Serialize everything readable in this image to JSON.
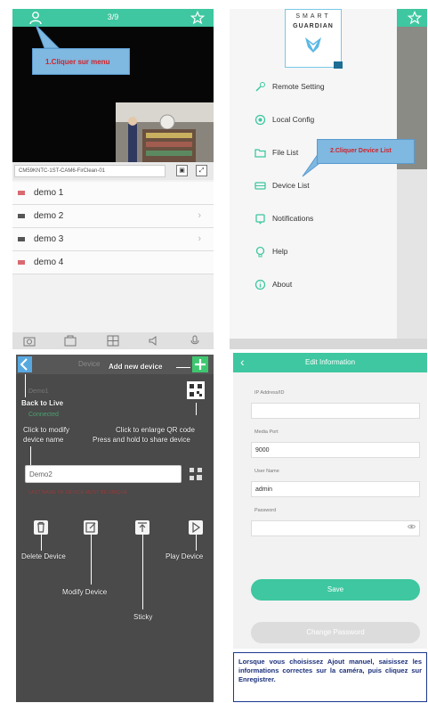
{
  "panel1": {
    "page_indicator": "3/9",
    "callout": "1.Cliquer sur menu",
    "path_text": "CM59KNTC-1ST-CAM6-FirClean-01",
    "devices": [
      {
        "label": "demo 1"
      },
      {
        "label": "demo 2"
      },
      {
        "label": "demo 3"
      },
      {
        "label": "demo 4"
      }
    ],
    "icons": {
      "top_left": "person-icon",
      "top_right": "star-icon"
    },
    "colors": {
      "accent": "#3ec7a0",
      "callout_bg": "#7fb8e0",
      "callout_text": "#d2232a"
    }
  },
  "panel2": {
    "logo_line1": "SMART",
    "logo_line2": "GUARDIAN",
    "menu": [
      {
        "label": "Remote Setting",
        "icon": "settings-icon"
      },
      {
        "label": "Local Config",
        "icon": "gear-icon"
      },
      {
        "label": "File List",
        "icon": "folder-icon"
      },
      {
        "label": "Device List",
        "icon": "device-icon"
      },
      {
        "label": "Notifications",
        "icon": "bell-icon"
      },
      {
        "label": "Help",
        "icon": "help-icon"
      },
      {
        "label": "About",
        "icon": "info-icon"
      }
    ],
    "callout": "2.Cliquer Device List"
  },
  "panel3": {
    "title": "Device",
    "annotations": {
      "add_new_device": "Add new device",
      "back_to_live": "Back to Live",
      "click_modify_1": "Click to modify",
      "click_modify_2": "device name",
      "enlarge_qr_1": "Click to enlarge QR code",
      "enlarge_qr_2": "Press and hold to share device",
      "delete_device": "Delete Device",
      "modify_device": "Modify Device",
      "sticky": "Sticky",
      "play_device": "Play Device"
    },
    "name_value": "Demo2",
    "device_line": "Demo1",
    "status_line": "Connected",
    "warn_text": "LAST NAME OF DEVICE MUST BE UNIQUE"
  },
  "panel4": {
    "title": "Edit Information",
    "fields": [
      {
        "label": "IP Address/ID",
        "value": ""
      },
      {
        "label": "Media Port",
        "value": "9000"
      },
      {
        "label": "User Name",
        "value": "admin"
      },
      {
        "label": "Password",
        "value": ""
      }
    ],
    "save_label": "Save",
    "change_password_label": "Change Password",
    "note": "Lorsque vous choisissez Ajout manuel, saisissez les informations correctes sur la caméra, puis cliquez sur Enregistrer."
  }
}
